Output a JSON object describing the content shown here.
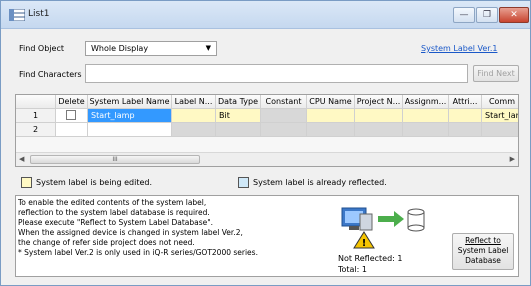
{
  "window": {
    "title": "List1",
    "minimize_glyph": "—",
    "restore_glyph": "❐",
    "close_glyph": "✕"
  },
  "search": {
    "find_object_label": "Find Object",
    "find_object_value": "Whole Display",
    "find_characters_label": "Find Characters",
    "find_characters_value": "",
    "find_next_label": "Find Next",
    "version_link": "System Label Ver.1"
  },
  "table": {
    "columns": [
      "Delete",
      "System Label Name",
      "Label N...",
      "Data Type",
      "Constant",
      "CPU Name",
      "Project N...",
      "Assignm...",
      "Attri...",
      "Comm"
    ],
    "rows": [
      {
        "num": "1",
        "delete": "",
        "system_label_name": "Start_lamp",
        "label_name": "",
        "data_type": "Bit",
        "constant": "",
        "cpu_name": "",
        "project_name": "",
        "assignment": "",
        "attribute": "",
        "comment": "Start_lamp"
      },
      {
        "num": "2",
        "delete": "",
        "system_label_name": "",
        "label_name": "",
        "data_type": "",
        "constant": "",
        "cpu_name": "",
        "project_name": "",
        "assignment": "",
        "attribute": "",
        "comment": ""
      }
    ],
    "scroll_thumb_glyph": "III"
  },
  "legend": {
    "editing_label": "System label is being edited.",
    "editing_color": "#fff9c4",
    "reflected_label": "System label is already reflected.",
    "reflected_color": "#cfe8f8"
  },
  "info": {
    "lines": [
      "To enable the edited contents of the system label,",
      "reflection to the system label database is required.",
      "Please execute \"Reflect to System Label Database\".",
      "When the assigned device is changed in system label Ver.2,",
      "the change of refer side project does not need.",
      "* System label Ver.2 is only used in iQ-R series/GOT2000 series."
    ],
    "not_reflected": "Not Reflected: 1",
    "total": "Total: 1",
    "reflect_button_lines": [
      "Reflect to",
      "System Label",
      "Database"
    ]
  },
  "colors": {
    "selected_cell": "#3399ff",
    "editing_row": "#fff9c4",
    "gray_cell": "#d8d8d8",
    "link": "#1a58c8"
  }
}
